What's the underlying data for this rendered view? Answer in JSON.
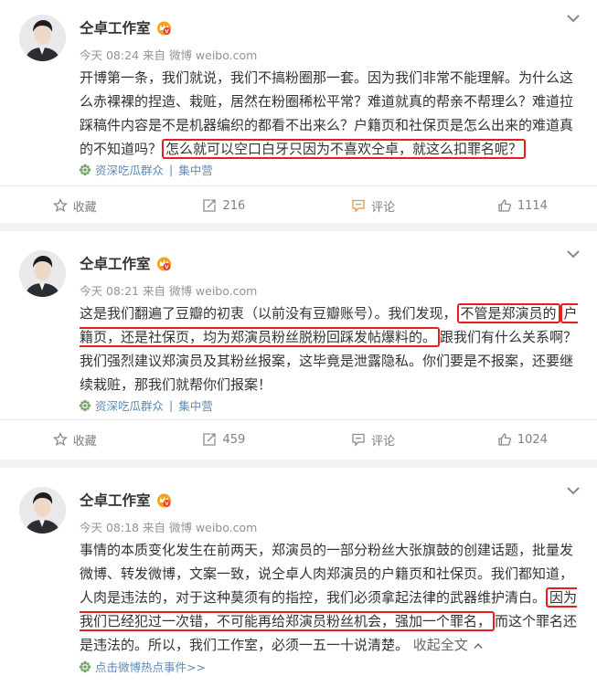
{
  "posts": [
    {
      "author": "仝卓工作室",
      "meta": "今天 08:24 来自 微博 weibo.com",
      "text_plain": "开博第一条，我们就说，我们不搞粉圈那一套。因为我们非常不能理解。为什么这么赤裸裸的捏造、栽赃，居然在粉圈稀松平常？难道就真的帮亲不帮理么？难道拉踩稿件内容是不是机器编织的都看不出来么？户籍页和社保页是怎么出来的难道真的不知道吗？",
      "text_highlight": "怎么就可以空口白牙只因为不喜欢仝卓，就这么扣罪名呢？",
      "source": "资深吃瓜群众",
      "source_sep": "|",
      "source_app": "集中营",
      "actions": {
        "favorite": "收藏",
        "repost": "216",
        "comment": "评论",
        "like": "1114"
      }
    },
    {
      "author": "仝卓工作室",
      "meta": "今天 08:21 来自 微博 weibo.com",
      "text_a": "这是我们翻遍了豆瓣的初衷（以前没有豆瓣账号）。我们发现，",
      "text_highlight_1": "不管是郑演员的",
      "text_highlight_2": "户籍页，还是社保页，均为郑演员粉丝脱粉回踩发帖爆料的。",
      "text_b": "跟我们有什么关系啊？我们强烈建议郑演员及其粉丝报案，这毕竟是泄露隐私。你们要是不报案，还要继续栽赃，那我们就帮你们报案！",
      "source": "资深吃瓜群众",
      "source_sep": "|",
      "source_app": "集中营",
      "actions": {
        "favorite": "收藏",
        "repost": "459",
        "comment": "评论",
        "like": "1024"
      }
    },
    {
      "author": "仝卓工作室",
      "meta": "今天 08:18 来自 微博 weibo.com",
      "text_a": "事情的本质变化发生在前两天，郑演员的一部分粉丝大张旗鼓的创建话题，批量发微博、转发微博，文案一致，说仝卓人肉郑演员的户籍页和社保页。我们都知道，人肉是违法的，对于这种莫须有的指控，我们必须拿起法律的武器维护清白。",
      "text_highlight": "因为我们已经犯过一次错，不可能再给郑演员粉丝机会，强加一个罪名，",
      "text_b": "而这个罪名还是违法的。所以，我们工作室，必须一五一十说清楚。",
      "more_label": "收起全文",
      "source": "点击微博热点事件>>"
    }
  ],
  "colors": {
    "highlight_border": "#e61e1e",
    "link": "#5b8ab8",
    "meta": "#939393",
    "page_bg": "#f2f2f2"
  },
  "icons": [
    "avatar",
    "vip-crown-icon",
    "chevron-down-icon",
    "source-flower-icon",
    "star-icon",
    "repost-icon",
    "comment-icon",
    "like-icon"
  ]
}
